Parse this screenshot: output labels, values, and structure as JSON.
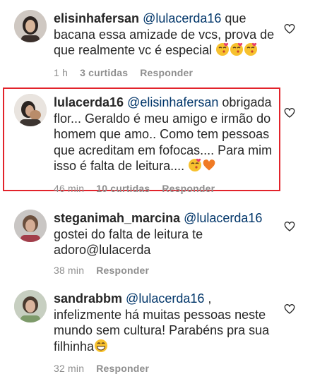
{
  "comments": [
    {
      "username": "elisinhafersan",
      "mention": "@lulacerda16",
      "body": " que bacana essa amizade de vcs, prova de que realmente vc é especial ",
      "emoji": [
        "kiss-face",
        "kiss-face",
        "kiss-face"
      ],
      "time": "1 h",
      "likes": "3 curtidas",
      "reply": "Responder"
    },
    {
      "username": "lulacerda16",
      "mention": "@elisinhafersan",
      "body": " obrigada flor... Geraldo é meu amigo e irmão do homem que amo.. Como tem pessoas que acreditam em fofocas.... Para mim isso é falta de leitura.... ",
      "emoji": [
        "kiss-face",
        "orange-heart"
      ],
      "time": "46 min",
      "likes": "10 curtidas",
      "reply": "Responder"
    },
    {
      "username": "steganimah_marcina",
      "mention": "@lulacerda16",
      "body": " gostei do falta de leitura te adoro@lulacerda",
      "emoji": [],
      "time": "38 min",
      "likes": "",
      "reply": "Responder"
    },
    {
      "username": "sandrabbm",
      "mention": "@lulacerda16",
      "body": " , infelizmente há muitas pessoas neste mundo sem cultura! Parabéns pra sua filhinha",
      "emoji": [
        "grinning-face"
      ],
      "time": "32 min",
      "likes": "",
      "reply": "Responder"
    }
  ],
  "colors": {
    "text": "#262626",
    "mention": "#003569",
    "meta": "#8e8e8e",
    "highlight_border": "#e2232b"
  },
  "icons": {
    "like": "heart-outline-icon"
  }
}
